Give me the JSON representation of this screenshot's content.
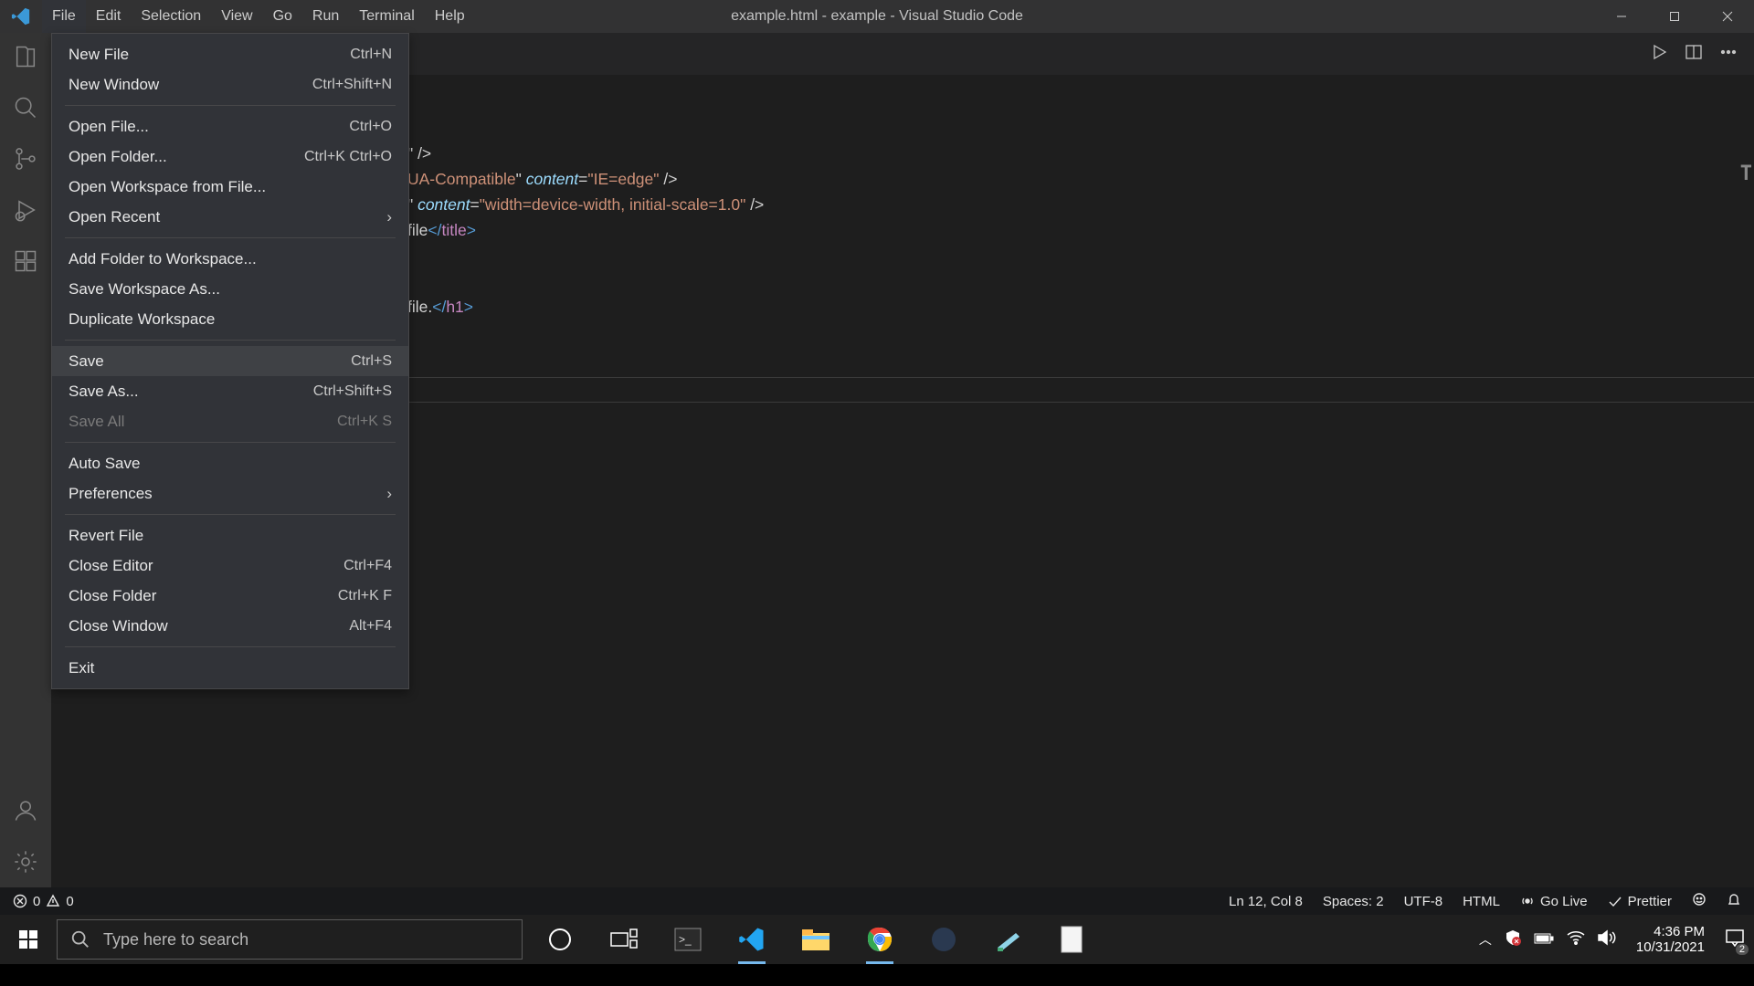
{
  "title": "example.html - example - Visual Studio Code",
  "menubar": [
    "File",
    "Edit",
    "Selection",
    "View",
    "Go",
    "Run",
    "Terminal",
    "Help"
  ],
  "menubar_open_index": 0,
  "file_menu": {
    "groups": [
      [
        {
          "label": "New File",
          "kb": "Ctrl+N"
        },
        {
          "label": "New Window",
          "kb": "Ctrl+Shift+N"
        }
      ],
      [
        {
          "label": "Open File...",
          "kb": "Ctrl+O"
        },
        {
          "label": "Open Folder...",
          "kb": "Ctrl+K Ctrl+O"
        },
        {
          "label": "Open Workspace from File..."
        },
        {
          "label": "Open Recent",
          "submenu": true
        }
      ],
      [
        {
          "label": "Add Folder to Workspace..."
        },
        {
          "label": "Save Workspace As..."
        },
        {
          "label": "Duplicate Workspace"
        }
      ],
      [
        {
          "label": "Save",
          "kb": "Ctrl+S",
          "hover": true
        },
        {
          "label": "Save As...",
          "kb": "Ctrl+Shift+S"
        },
        {
          "label": "Save All",
          "kb": "Ctrl+K S",
          "disabled": true
        }
      ],
      [
        {
          "label": "Auto Save"
        },
        {
          "label": "Preferences",
          "submenu": true
        }
      ],
      [
        {
          "label": "Revert File"
        },
        {
          "label": "Close Editor",
          "kb": "Ctrl+F4"
        },
        {
          "label": "Close Folder",
          "kb": "Ctrl+K F"
        },
        {
          "label": "Close Window",
          "kb": "Alt+F4"
        }
      ],
      [
        {
          "label": "Exit"
        }
      ]
    ]
  },
  "editor_visible_lines": [
    {
      "plain": "\" />"
    },
    {
      "segments": [
        {
          "t": "UA-Compatible",
          "c": "str"
        },
        {
          "t": "\" ",
          "c": ""
        },
        {
          "t": "content",
          "c": "attr"
        },
        {
          "t": "=",
          "c": ""
        },
        {
          "t": "\"IE=edge\"",
          "c": "str"
        },
        {
          "t": " />",
          "c": ""
        }
      ]
    },
    {
      "segments": [
        {
          "t": "\" ",
          "c": ""
        },
        {
          "t": "content",
          "c": "attr"
        },
        {
          "t": "=",
          "c": ""
        },
        {
          "t": "\"width=device-width, initial-scale=1.0\"",
          "c": "str"
        },
        {
          "t": " />",
          "c": ""
        }
      ]
    },
    {
      "segments": [
        {
          "t": "file",
          "c": ""
        },
        {
          "t": "</",
          "c": "tag"
        },
        {
          "t": "title",
          "c": "pink"
        },
        {
          "t": ">",
          "c": "tag"
        }
      ]
    },
    {
      "plain": ""
    },
    {
      "plain": ""
    },
    {
      "segments": [
        {
          "t": "file.",
          "c": ""
        },
        {
          "t": "</",
          "c": "tag"
        },
        {
          "t": "h1",
          "c": "pink"
        },
        {
          "t": ">",
          "c": "tag"
        }
      ]
    }
  ],
  "status": {
    "errors": "0",
    "warnings": "0",
    "position": "Ln 12, Col 8",
    "spaces": "Spaces: 2",
    "encoding": "UTF-8",
    "lang": "HTML",
    "golive": "Go Live",
    "prettier": "Prettier"
  },
  "taskbar": {
    "search_placeholder": "Type here to search",
    "time": "4:36 PM",
    "date": "10/31/2021",
    "notif_count": "2"
  }
}
